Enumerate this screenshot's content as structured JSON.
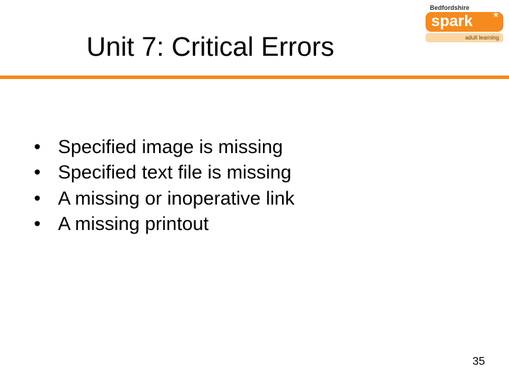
{
  "logo": {
    "top_text": "Bedfordshire",
    "brand": "spark",
    "bottom_text": "adult learning"
  },
  "title": "Unit 7: Critical Errors",
  "bullets": [
    "Specified image is missing",
    "Specified text file is missing",
    "A missing or inoperative link",
    "A missing printout"
  ],
  "page_number": "35"
}
